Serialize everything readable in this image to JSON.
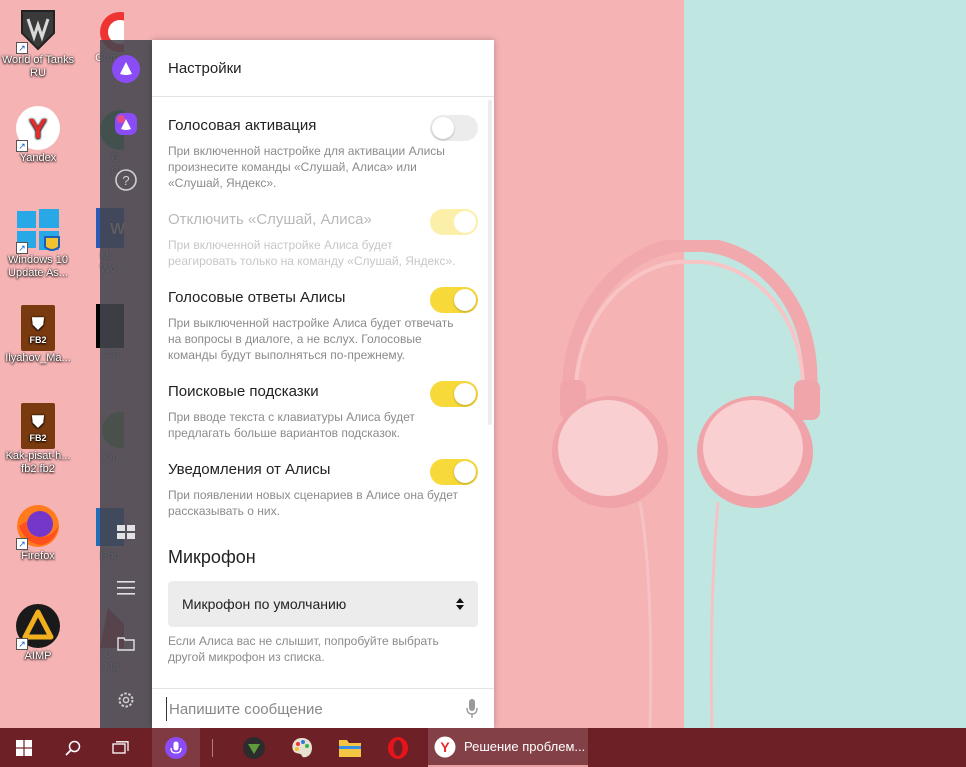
{
  "desktop": {
    "icons": [
      {
        "label": "World of Tanks RU",
        "icon": "tank-icon"
      },
      {
        "label": "Yandex",
        "icon": "yandex-icon"
      },
      {
        "label": "Windows 10 Update As...",
        "icon": "windows-logo-icon"
      },
      {
        "label": "Ilyahov_Ma...",
        "icon": "fb2-book-icon"
      },
      {
        "label": "Kak-pisat-h... fb2.fb2",
        "icon": "fb2-book-icon"
      },
      {
        "label": "Firefox",
        "icon": "firefox-icon"
      },
      {
        "label": "AIMP",
        "icon": "aimp-icon"
      }
    ],
    "partial_icons": [
      {
        "label": "Gam",
        "icon": "game-center-icon"
      },
      {
        "label": "G Cl",
        "icon": "chrome-icon"
      },
      {
        "label": "Mi Wo",
        "icon": "word-icon"
      },
      {
        "label": "Nat",
        "icon": "black-square-icon"
      },
      {
        "label": "Or",
        "icon": "origin-icon"
      },
      {
        "label": "Pho",
        "icon": "photo-icon"
      },
      {
        "label": "C Ma",
        "icon": "app-icon"
      }
    ],
    "fb2_badge": "FB2"
  },
  "panel": {
    "title": "Настройки",
    "settings": [
      {
        "title": "Голосовая активация",
        "desc": "При включенной настройке для активации Алисы произнесите команды «Слушай, Алиса» или «Слушай, Яндекс».",
        "state": "off"
      },
      {
        "title": "Отключить «Слушай, Алиса»",
        "desc": "При включенной настройке Алиса будет реагировать только на команду «Слушай, Яндекс».",
        "state": "disabled-on"
      },
      {
        "title": "Голосовые ответы Алисы",
        "desc": "При выключенной настройке Алиса будет отвечать на вопросы в диалоге, а не вслух. Голосовые команды будут выполняться по-прежнему.",
        "state": "on"
      },
      {
        "title": "Поисковые подсказки",
        "desc": "При вводе текста с клавиатуры Алиса будет предлагать больше вариантов подсказок.",
        "state": "on"
      },
      {
        "title": "Уведомления от Алисы",
        "desc": "При появлении новых сценариев в Алисе она будет рассказывать о них.",
        "state": "on"
      }
    ],
    "microphone": {
      "section_title": "Микрофон",
      "selected": "Микрофон по умолчанию",
      "hint": "Если Алиса вас не слышит, попробуйте выбрать другой микрофон из списка."
    },
    "input_placeholder": "Напишите сообщение"
  },
  "taskbar": {
    "app_label": "Решение проблем..."
  },
  "colors": {
    "accent_toggle": "#f7d93a",
    "alice_purple": "#7b3cf5",
    "taskbar": "#6e2027"
  }
}
